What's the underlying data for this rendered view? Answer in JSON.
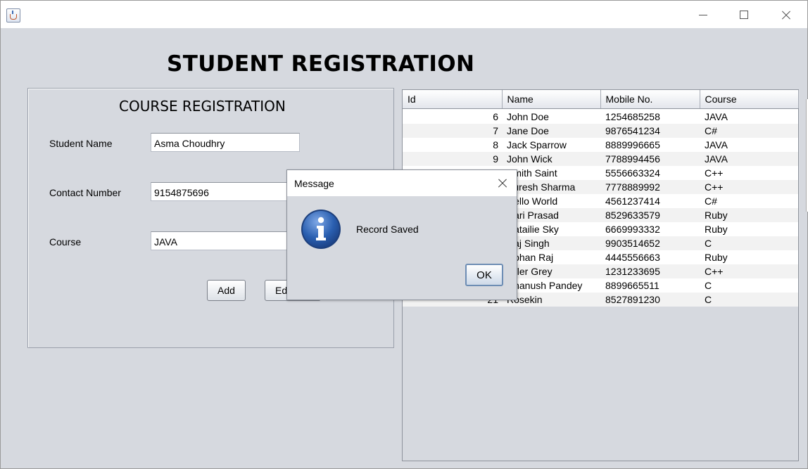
{
  "window": {
    "title": "",
    "controls": {
      "minimize": "minimize-icon",
      "maximize": "maximize-icon",
      "close": "close-icon"
    }
  },
  "header": {
    "title": "STUDENT REGISTRATION"
  },
  "form": {
    "title": "COURSE REGISTRATION",
    "student_name_label": "Student Name",
    "student_name_value": "Asma Choudhry",
    "contact_number_label": "Contact Number",
    "contact_number_value": "9154875696",
    "course_label": "Course",
    "course_value": "JAVA",
    "add_label": "Add",
    "edit_label": "Edit"
  },
  "table": {
    "columns": [
      "Id",
      "Name",
      "Mobile No.",
      "Course"
    ],
    "rows": [
      {
        "id": "6",
        "name": "John Doe",
        "mobile": "1254685258",
        "course": "JAVA"
      },
      {
        "id": "7",
        "name": "Jane Doe",
        "mobile": "9876541234",
        "course": "C#"
      },
      {
        "id": "8",
        "name": "Jack Sparrow",
        "mobile": "8889996665",
        "course": "JAVA"
      },
      {
        "id": "9",
        "name": "John Wick",
        "mobile": "7788994456",
        "course": "JAVA"
      },
      {
        "id": "",
        "name": "Smith Saint",
        "mobile": "5556663324",
        "course": "C++"
      },
      {
        "id": "",
        "name": "Suresh Sharma",
        "mobile": "7778889992",
        "course": "C++"
      },
      {
        "id": "",
        "name": "Hello World",
        "mobile": "4561237414",
        "course": "C#"
      },
      {
        "id": "",
        "name": "Hari Prasad",
        "mobile": "8529633579",
        "course": "Ruby"
      },
      {
        "id": "",
        "name": "Natailie Sky",
        "mobile": "6669993332",
        "course": "Ruby"
      },
      {
        "id": "",
        "name": "Raj Singh",
        "mobile": "9903514652",
        "course": "C"
      },
      {
        "id": "",
        "name": "Rohan Raj",
        "mobile": "4445556663",
        "course": "Ruby"
      },
      {
        "id": "",
        "name": "Tyler Grey",
        "mobile": "1231233695",
        "course": "C++"
      },
      {
        "id": "",
        "name": "Dhanush Pandey",
        "mobile": "8899665511",
        "course": "C"
      },
      {
        "id": "21",
        "name": "Rosekin",
        "mobile": "8527891230",
        "course": "C"
      }
    ]
  },
  "dialog": {
    "title": "Message",
    "message": "Record Saved",
    "ok_label": "OK",
    "icon": "info-icon"
  },
  "colors": {
    "background": "#d6d9df",
    "info_icon": "#2a5fb0",
    "ok_border": "#6d8db4"
  }
}
